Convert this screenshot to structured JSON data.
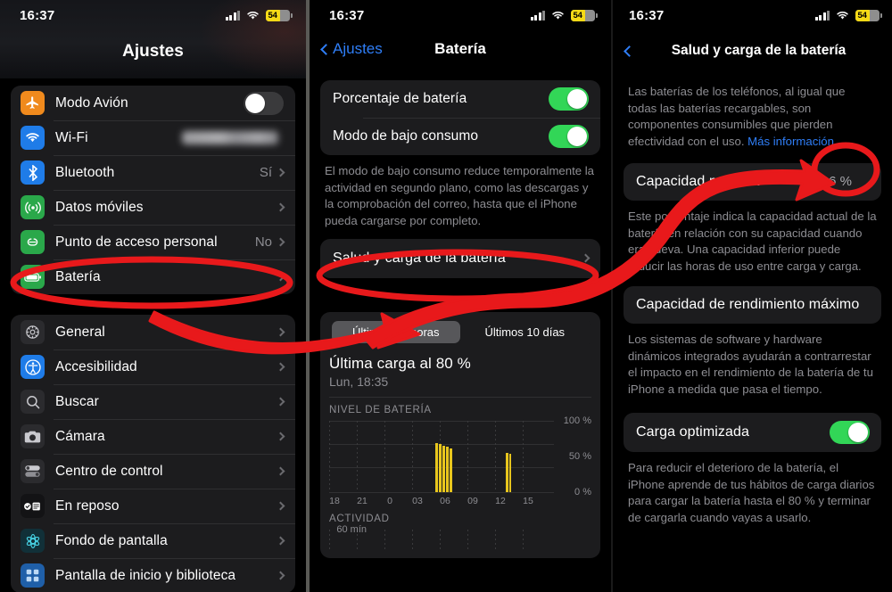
{
  "status_bar": {
    "time": "16:37",
    "battery_percent": "54",
    "wifi_icon": "wifi-icon",
    "signal_icon": "cellular-signal-icon"
  },
  "panel1": {
    "title": "Ajustes",
    "group1": [
      {
        "label": "Modo Avión",
        "icon": "airplane-icon",
        "icon_bg": "#f08a1d",
        "control": "toggle",
        "on": false
      },
      {
        "label": "Wi-Fi",
        "icon": "wifi-icon",
        "icon_bg": "#1f7ce8",
        "control": "blurred-value"
      },
      {
        "label": "Bluetooth",
        "icon": "bluetooth-icon",
        "icon_bg": "#1f7ce8",
        "value": "Sí",
        "control": "chevron"
      },
      {
        "label": "Datos móviles",
        "icon": "cellular-icon",
        "icon_bg": "#2aa84a",
        "control": "chevron"
      },
      {
        "label": "Punto de acceso personal",
        "icon": "hotspot-icon",
        "icon_bg": "#2aa84a",
        "value": "No",
        "control": "chevron"
      },
      {
        "label": "Batería",
        "icon": "battery-icon",
        "icon_bg": "#2aa84a",
        "control": "chevron",
        "highlighted": true
      }
    ],
    "group2": [
      {
        "label": "General",
        "icon": "gear-icon",
        "icon_bg": "#6a6a6e",
        "control": "chevron"
      },
      {
        "label": "Accesibilidad",
        "icon": "accessibility-icon",
        "icon_bg": "#1f7ce8",
        "control": "chevron"
      },
      {
        "label": "Buscar",
        "icon": "search-icon",
        "icon_bg": "#4a4a4e",
        "control": "chevron"
      },
      {
        "label": "Cámara",
        "icon": "camera-icon",
        "icon_bg": "#4a4a4e",
        "control": "chevron"
      },
      {
        "label": "Centro de control",
        "icon": "control-center-icon",
        "icon_bg": "#4a4a4e",
        "control": "chevron"
      },
      {
        "label": "En reposo",
        "icon": "standby-icon",
        "icon_bg": "#1c1c1e",
        "control": "chevron"
      },
      {
        "label": "Fondo de pantalla",
        "icon": "wallpaper-icon",
        "icon_bg": "#16343c",
        "control": "chevron"
      },
      {
        "label": "Pantalla de inicio y biblioteca",
        "icon": "home-screen-icon",
        "icon_bg": "#1f5fa8",
        "control": "chevron"
      }
    ]
  },
  "panel2": {
    "back_label": "Ajustes",
    "title": "Batería",
    "rows": [
      {
        "label": "Porcentaje de batería",
        "control": "toggle",
        "on": true
      },
      {
        "label": "Modo de bajo consumo",
        "control": "toggle",
        "on": true
      }
    ],
    "footer": "El modo de bajo consumo reduce temporalmente la actividad en segundo plano, como las descargas y la comprobación del correo, hasta que el iPhone pueda cargarse por completo.",
    "health_row": {
      "label": "Salud y carga de la batería",
      "highlighted": true
    },
    "segmented": {
      "options": [
        "Últimas 24 horas",
        "Últimos 10 días"
      ],
      "selected": "Últimas 24 horas"
    },
    "last_charge_title": "Última carga al 80 %",
    "last_charge_sub": "Lun, 18:35",
    "battery_level_label": "NIVEL DE BATERÍA",
    "activity_label": "ACTIVIDAD",
    "activity_max": "60 mín"
  },
  "panel3": {
    "title": "Salud y carga de la batería",
    "intro": "Las baterías de los teléfonos, al igual que todas las baterías recargables, son componentes consumibles que pierden efectividad con el uso.",
    "intro_link": "Más información...",
    "max_capacity": {
      "label": "Capacidad máxima",
      "value": "96 %",
      "circled": true
    },
    "max_capacity_footer": "Este porcentaje indica la capacidad actual de la batería en relación con su capacidad cuando era nueva. Una capacidad inferior puede reducir las horas de uso entre carga y carga.",
    "peak_perf": {
      "label": "Capacidad de rendimiento máximo"
    },
    "peak_perf_footer": "Los sistemas de software y hardware dinámicos integrados ayudarán a contrarrestar el impacto en el rendimiento de la batería de tu iPhone a medida que pasa el tiempo.",
    "optimized": {
      "label": "Carga optimizada",
      "control": "toggle",
      "on": true
    },
    "optimized_footer": "Para reducir el deterioro de la batería, el iPhone aprende de tus hábitos de carga diarios para cargar la batería hasta el 80 % y terminar de cargarla cuando vayas a usarlo."
  },
  "annotation_color": "#e8191b",
  "chart_data": {
    "type": "bar",
    "title": "NIVEL DE BATERÍA",
    "xlabel": "",
    "ylabel": "%",
    "ylim": [
      0,
      100
    ],
    "ytick_labels": [
      "100 %",
      "50 %",
      "0 %"
    ],
    "yticks": [
      100,
      50,
      0
    ],
    "x_tick_labels": [
      "18",
      "21",
      "0",
      "03",
      "06",
      "09",
      "12",
      "15"
    ],
    "x": [
      6.4,
      6.7,
      7.0,
      7.3,
      7.6,
      15.4,
      15.6
    ],
    "values": [
      68,
      66,
      64,
      62,
      60,
      54,
      53
    ],
    "bar_color": "#e8c61d",
    "grid": true,
    "legend": "none"
  }
}
